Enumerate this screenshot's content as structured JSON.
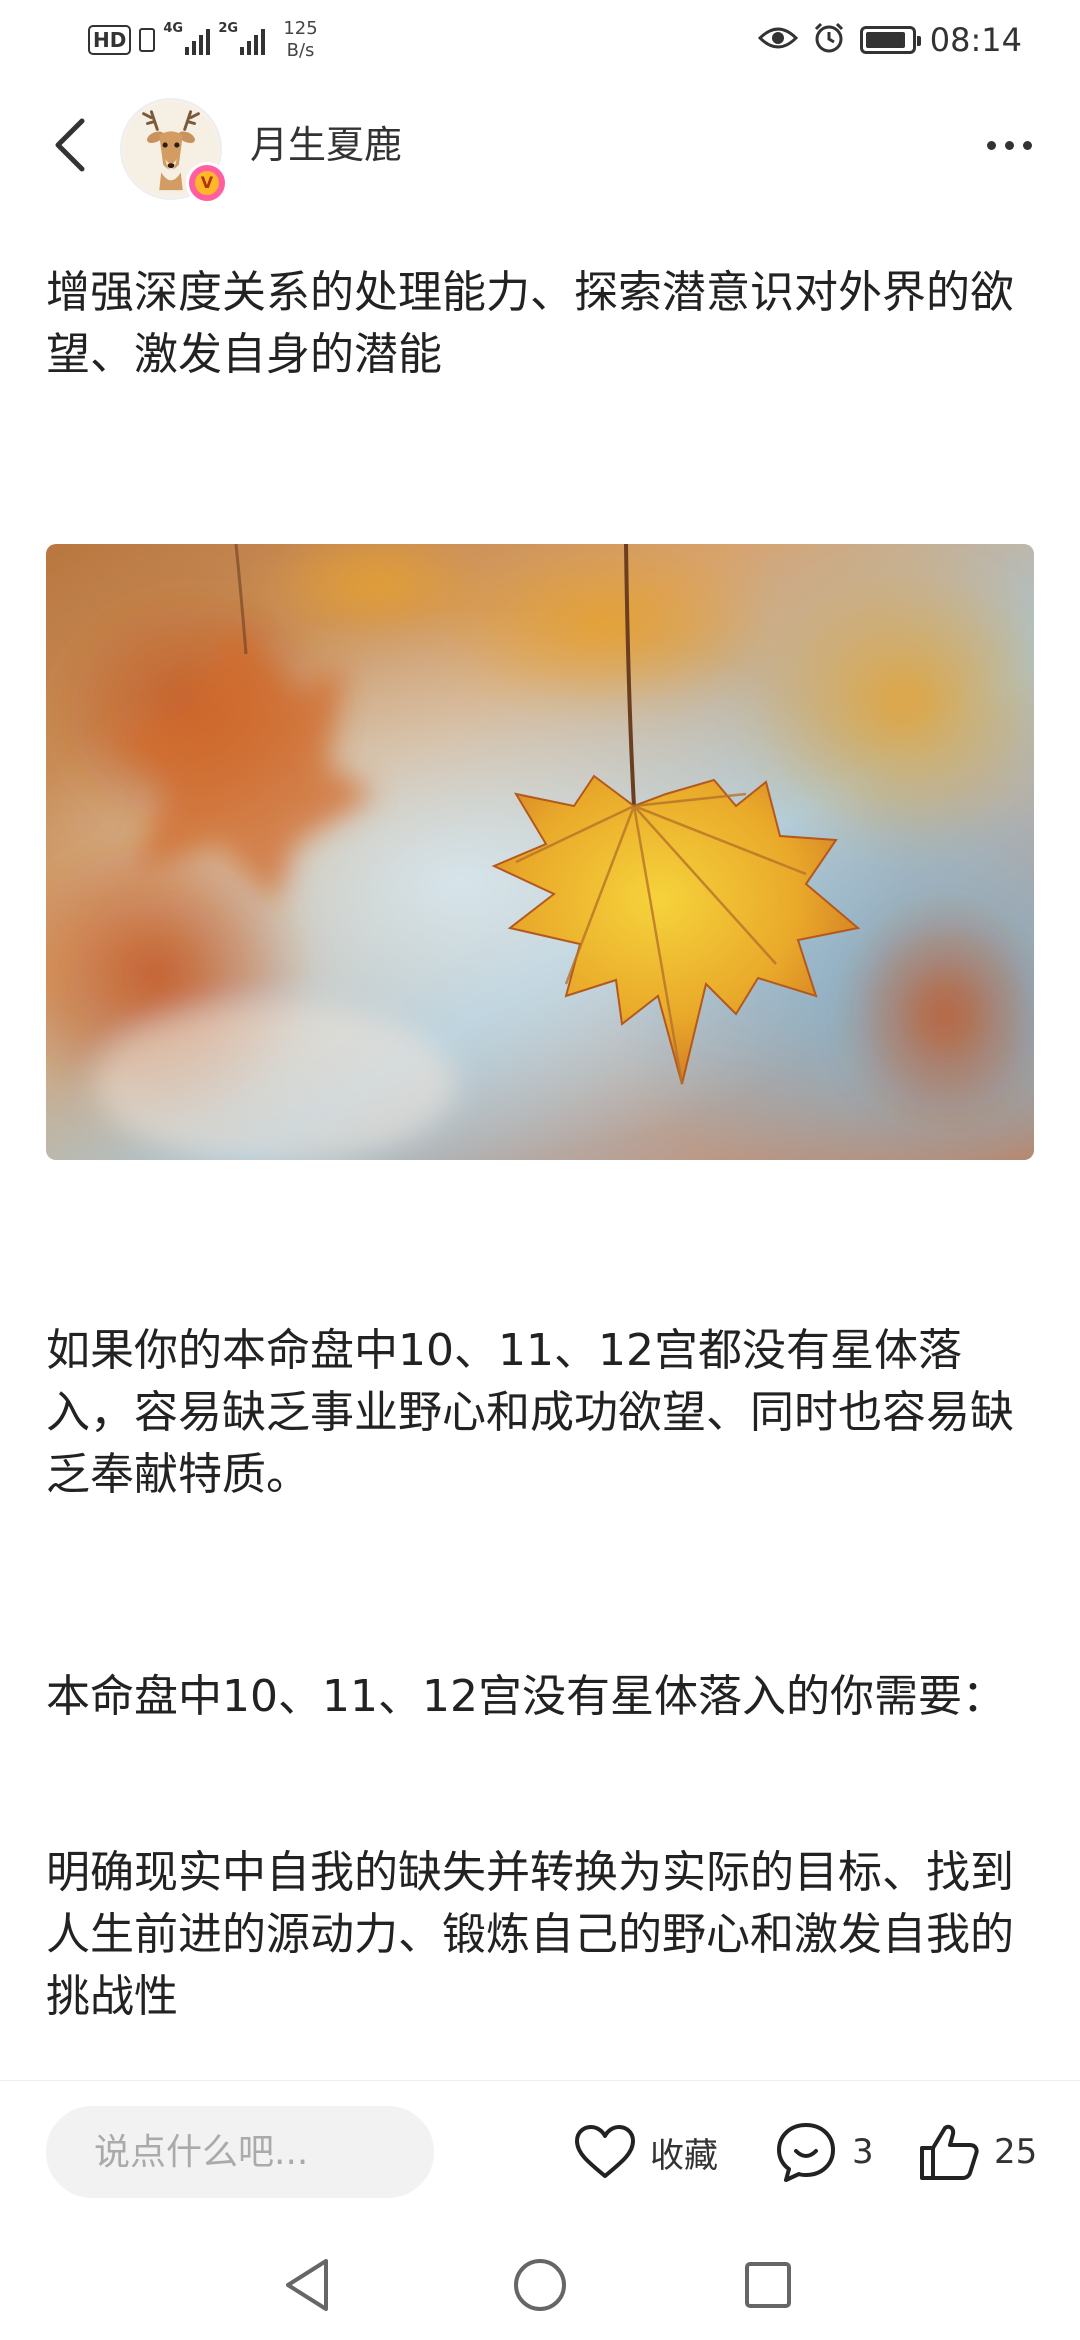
{
  "status_bar": {
    "hd_label": "HD",
    "sim1_net": "4G",
    "sim2_net": "2G",
    "speed_value": "125",
    "speed_unit": "B/s",
    "time": "08:14",
    "icons": [
      "eye-icon",
      "alarm-icon",
      "battery-icon"
    ]
  },
  "header": {
    "back_icon": "chevron-left-icon",
    "author_name": "月生夏鹿",
    "badge_label": "V",
    "more_icon": "more-dots-icon"
  },
  "article": {
    "paragraph_1": "增强深度关系的处理能力、探索潜意识对外界的欲望、激发自身的潜能",
    "image_subject": "autumn-maple-leaf-photo",
    "paragraph_2": "如果你的本命盘中10、11、12宫都没有星体落入，容易缺乏事业野心和成功欲望、同时也容易缺乏奉献特质。",
    "paragraph_3": "本命盘中10、11、12宫没有星体落入的你需要：",
    "paragraph_4": "明确现实中自我的缺失并转换为实际的目标、找到人生前进的源动力、锻炼自己的野心和激发自我的挑战性"
  },
  "bottom_bar": {
    "comment_placeholder": "说点什么吧...",
    "favorite_label": "收藏",
    "comment_count": "3",
    "like_count": "25"
  },
  "nav_bar": {
    "buttons": [
      "nav-back-icon",
      "nav-home-icon",
      "nav-recent-icon"
    ]
  },
  "colors": {
    "text": "#222222",
    "badge_pink": "#ff5fa0",
    "badge_gold": "#ffb627",
    "input_bg": "#f2f2f2"
  }
}
